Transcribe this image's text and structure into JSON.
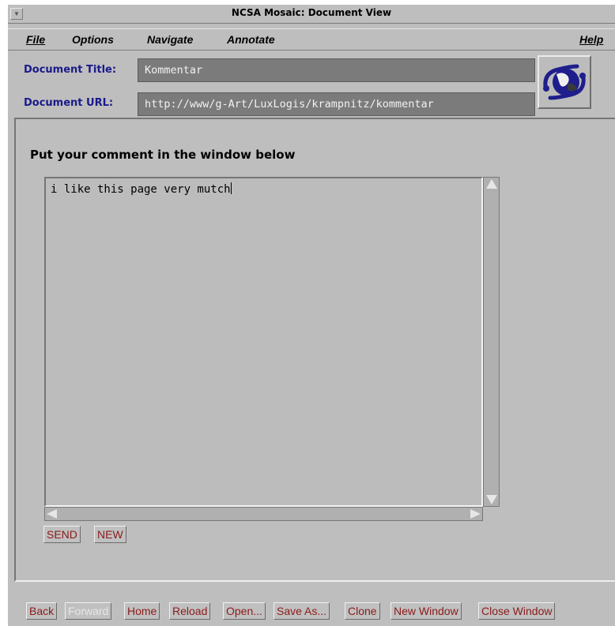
{
  "window": {
    "title": "NCSA Mosaic: Document View"
  },
  "menubar": {
    "file": "File",
    "options": "Options",
    "navigate": "Navigate",
    "annotate": "Annotate",
    "help": "Help"
  },
  "doc": {
    "title_label": "Document Title:",
    "title_value": "Kommentar",
    "url_label": "Document URL:",
    "url_value": "http://www/g-Art/LuxLogis/krampnitz/kommentar"
  },
  "page": {
    "heading": "Put your comment in the window below",
    "comment_text": "i like this page very mutch",
    "send_label": "SEND",
    "new_label": "NEW"
  },
  "toolbar": {
    "back": "Back",
    "forward": "Forward",
    "home": "Home",
    "reload": "Reload",
    "open": "Open...",
    "save_as": "Save As...",
    "clone": "Clone",
    "new_window": "New Window",
    "close_window": "Close Window"
  },
  "colors": {
    "background": "#bebebe",
    "label_blue": "#1a1a8a",
    "button_text": "#8b1a1a",
    "field_bg": "#7b7b7b"
  },
  "icons": {
    "logo": "mosaic-globe-logo-icon",
    "window_menu": "window-menu-icon"
  }
}
